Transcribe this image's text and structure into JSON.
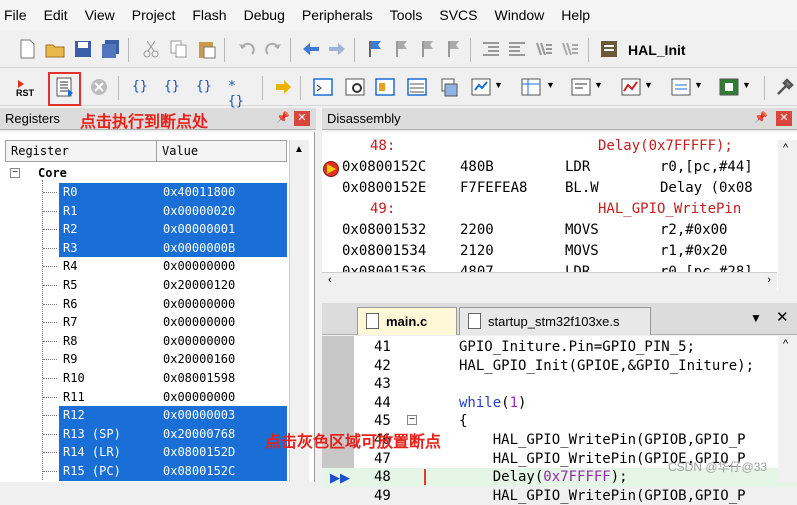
{
  "menu": [
    "File",
    "Edit",
    "View",
    "Project",
    "Flash",
    "Debug",
    "Peripherals",
    "Tools",
    "SVCS",
    "Window",
    "Help"
  ],
  "toolbar": {
    "target_label": "HAL_Init"
  },
  "registers": {
    "title": "Registers",
    "annotation": "点击执行到断点处",
    "columns": [
      "Register",
      "Value"
    ],
    "group": "Core",
    "rows": [
      {
        "name": "R0",
        "value": "0x40011800",
        "sel": true
      },
      {
        "name": "R1",
        "value": "0x00000020",
        "sel": true
      },
      {
        "name": "R2",
        "value": "0x00000001",
        "sel": true
      },
      {
        "name": "R3",
        "value": "0x0000000B",
        "sel": true
      },
      {
        "name": "R4",
        "value": "0x00000000",
        "sel": false
      },
      {
        "name": "R5",
        "value": "0x20000120",
        "sel": false
      },
      {
        "name": "R6",
        "value": "0x00000000",
        "sel": false
      },
      {
        "name": "R7",
        "value": "0x00000000",
        "sel": false
      },
      {
        "name": "R8",
        "value": "0x00000000",
        "sel": false
      },
      {
        "name": "R9",
        "value": "0x20000160",
        "sel": false
      },
      {
        "name": "R10",
        "value": "0x08001598",
        "sel": false
      },
      {
        "name": "R11",
        "value": "0x00000000",
        "sel": false
      },
      {
        "name": "R12",
        "value": "0x00000003",
        "sel": true
      },
      {
        "name": "R13 (SP)",
        "value": "0x20000768",
        "sel": true
      },
      {
        "name": "R14 (LR)",
        "value": "0x0800152D",
        "sel": true
      },
      {
        "name": "R15 (PC)",
        "value": "0x0800152C",
        "sel": true
      }
    ]
  },
  "disassembly": {
    "title": "Disassembly",
    "lines": [
      {
        "t": "src",
        "ln": "48:",
        "code": "Delay(0x7FFFFF);"
      },
      {
        "t": "asm",
        "addr": "0x0800152C",
        "hex": "480B",
        "op": "LDR",
        "args": "r0,[pc,#44]",
        "cur": true
      },
      {
        "t": "asm",
        "addr": "0x0800152E",
        "hex": "F7FEFEA8",
        "op": "BL.W",
        "args": "Delay (0x08"
      },
      {
        "t": "src",
        "ln": "49:",
        "code": "HAL_GPIO_WritePin"
      },
      {
        "t": "asm",
        "addr": "0x08001532",
        "hex": "2200",
        "op": "MOVS",
        "args": "r2,#0x00"
      },
      {
        "t": "asm",
        "addr": "0x08001534",
        "hex": "2120",
        "op": "MOVS",
        "args": "r1,#0x20"
      },
      {
        "t": "asm",
        "addr": "0x08001536",
        "hex": "4807",
        "op": "LDR",
        "args": "r0,[pc,#28]"
      }
    ]
  },
  "editor": {
    "tabs": [
      "main.c",
      "startup_stm32f103xe.s"
    ],
    "lines": [
      {
        "ln": "41",
        "code": "GPIO_Initure.Pin=GPIO_PIN_5;"
      },
      {
        "ln": "42",
        "code": "HAL_GPIO_Init(GPIOE,&GPIO_Initure);"
      },
      {
        "ln": "43",
        "code": ""
      },
      {
        "ln": "44",
        "code": "while(1)"
      },
      {
        "ln": "45",
        "code": "{"
      },
      {
        "ln": "46",
        "code": "    HAL_GPIO_WritePin(GPIOB,GPIO_P"
      },
      {
        "ln": "47",
        "code": "    HAL_GPIO_WritePin(GPIOE,GPIO_P"
      },
      {
        "ln": "48",
        "code": "    Delay(0x7FFFFF);"
      },
      {
        "ln": "49",
        "code": "    HAL_GPIO_WritePin(GPIOB,GPIO_P"
      }
    ],
    "annotation": "点击灰色区域可放置断点"
  },
  "watermark": "CSDN @华仔@33"
}
